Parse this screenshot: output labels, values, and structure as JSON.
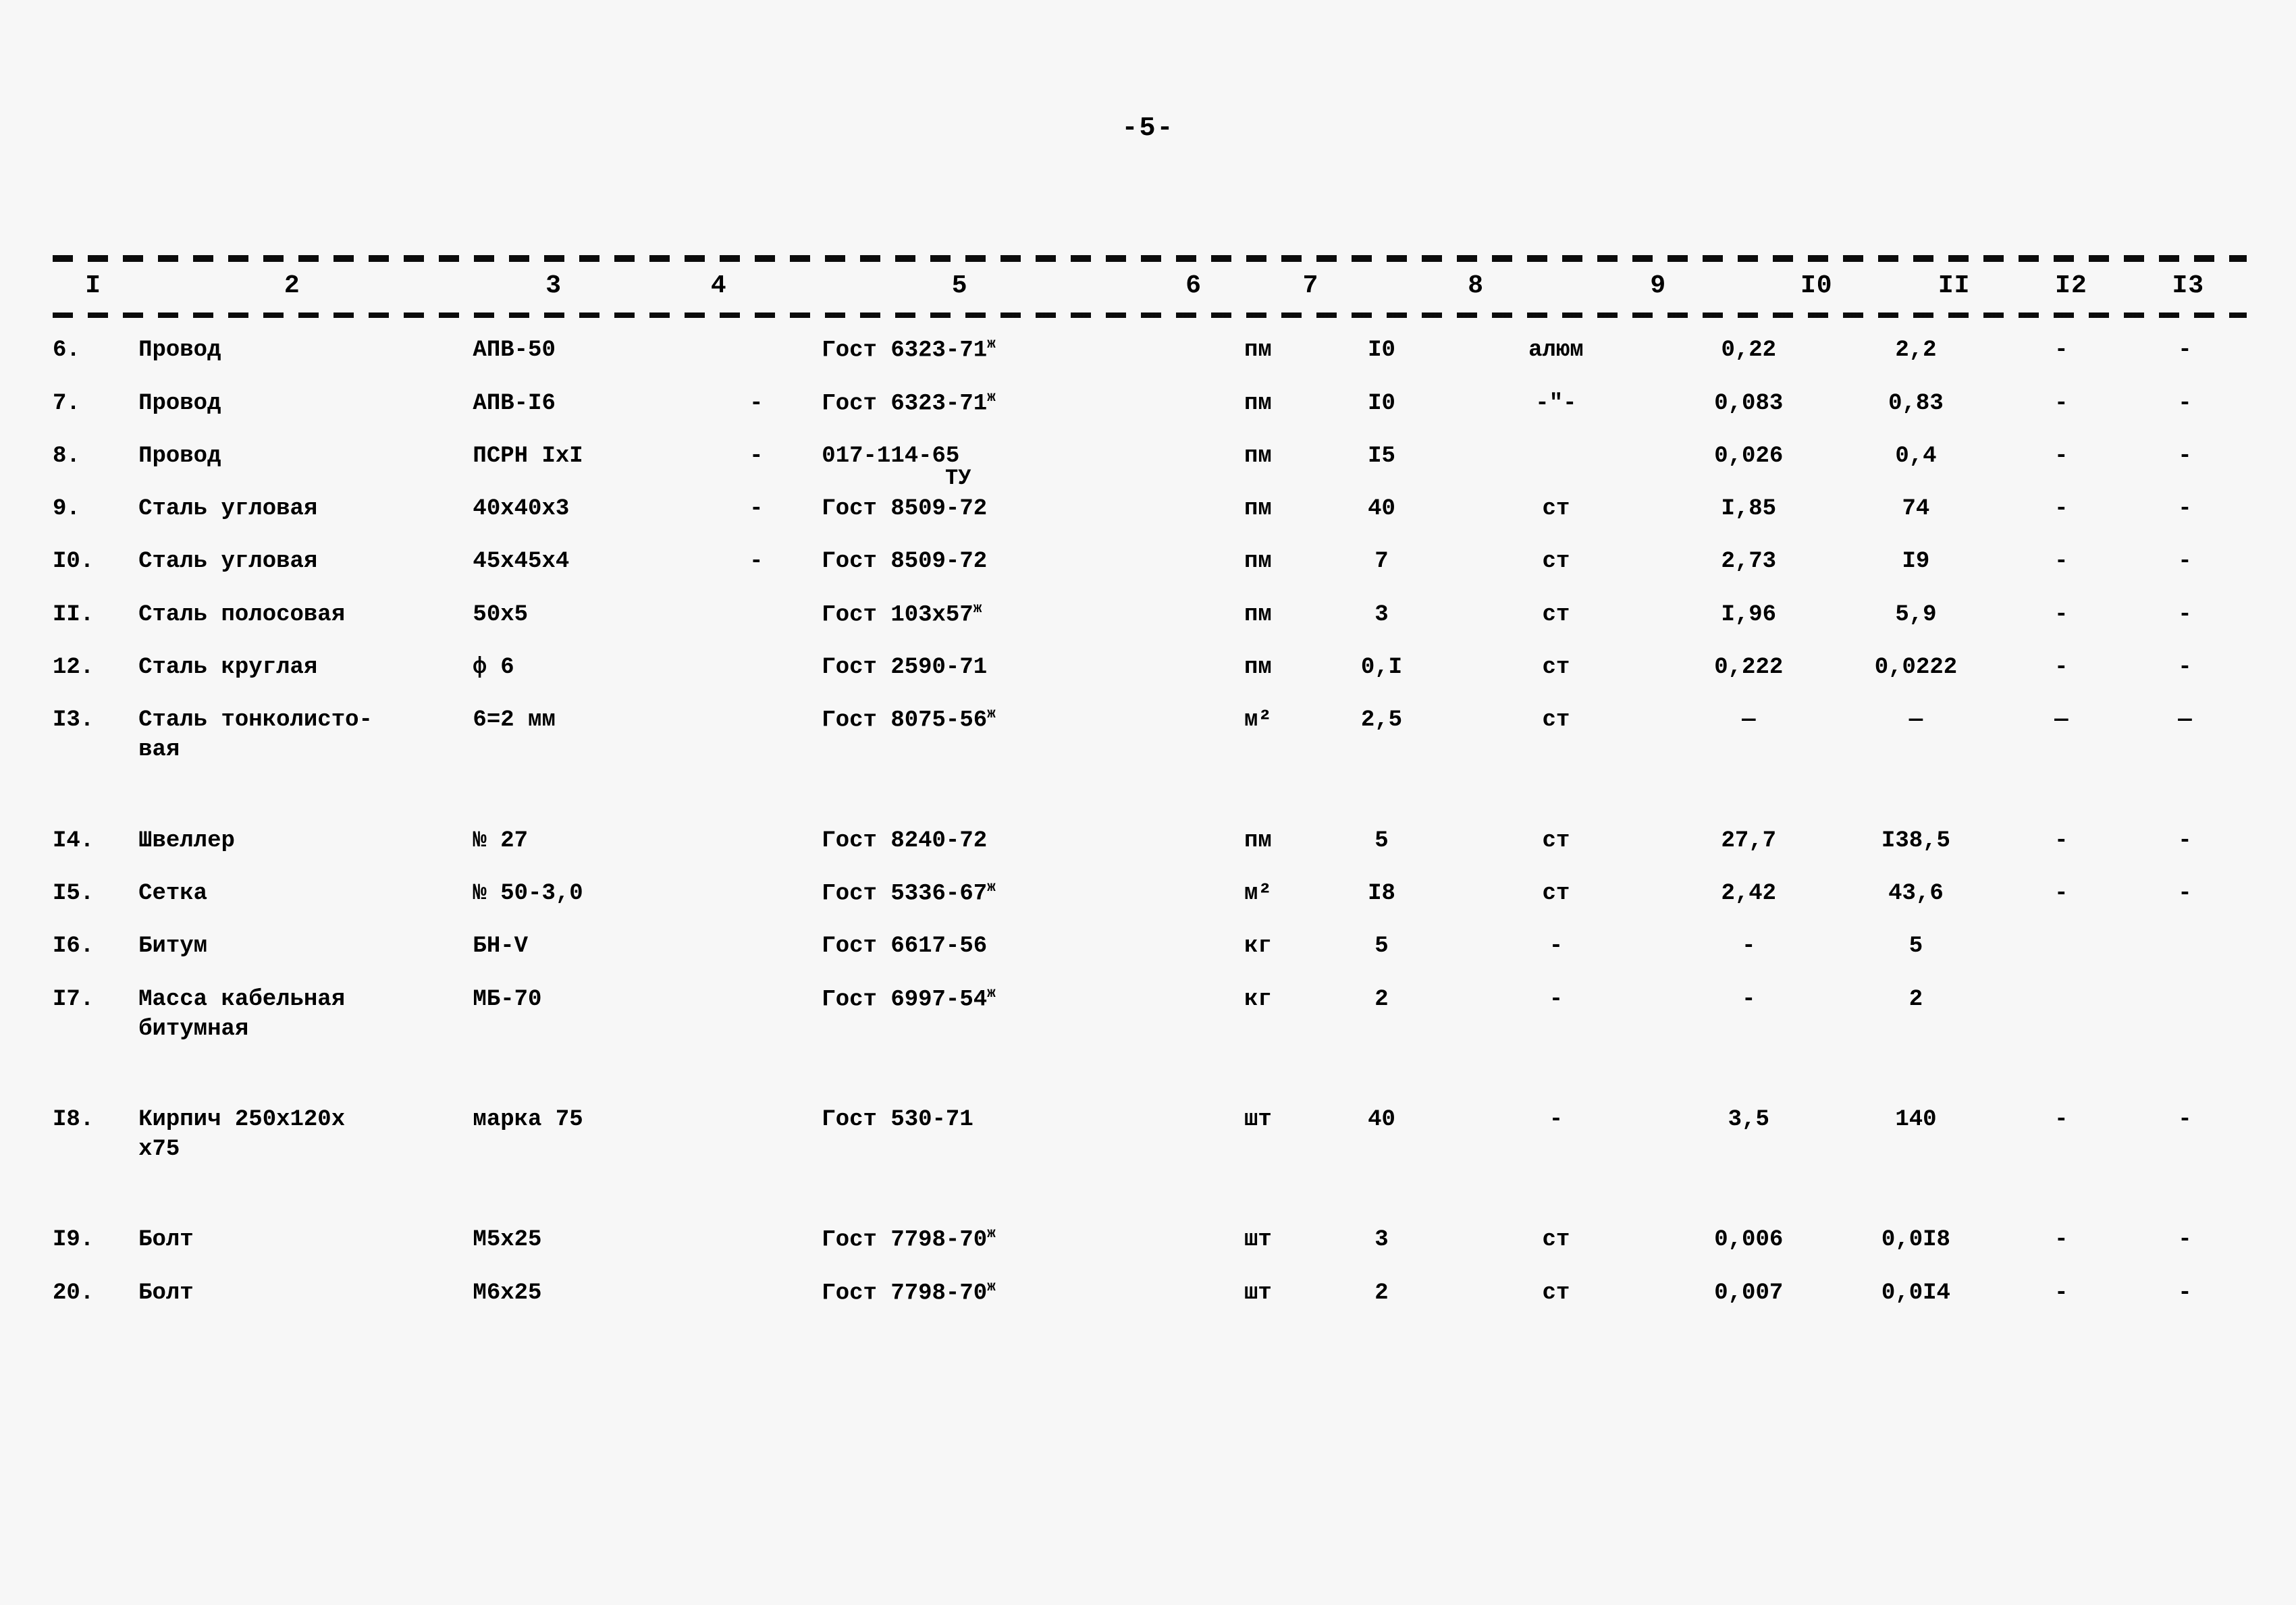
{
  "document": {
    "page_number": "-5-",
    "note_tu": "ТУ"
  },
  "table": {
    "column_headers": [
      "I",
      "2",
      "3",
      "4",
      "5",
      "6",
      "7",
      "8",
      "9",
      "I0",
      "II",
      "I2",
      "I3"
    ],
    "rows": [
      {
        "no": "6.",
        "name": "Провод",
        "mark": "АПВ-50",
        "c5": "",
        "standard": "Гост 6323-71",
        "standard_sup": "ж",
        "unit": "пм",
        "qty": "I0",
        "material": "алюм",
        "unit_weight": "0,22",
        "total_weight": "2,2",
        "c12": "-",
        "c13": "-"
      },
      {
        "no": "7.",
        "name": "Провод",
        "mark": "АПВ-I6",
        "c5": "-",
        "standard": "Гост 6323-71",
        "standard_sup": "ж",
        "unit": "пм",
        "qty": "I0",
        "material": "-\"-",
        "unit_weight": "0,083",
        "total_weight": "0,83",
        "c12": "-",
        "c13": "-"
      },
      {
        "no": "8.",
        "name": "Провод",
        "mark": "ПСРН IxI",
        "c5": "-",
        "standard": "017-114-65",
        "standard_sup": "",
        "unit": "пм",
        "qty": "I5",
        "material": "",
        "unit_weight": "0,026",
        "total_weight": "0,4",
        "c12": "-",
        "c13": "-"
      },
      {
        "no": "9.",
        "name": "Сталь угловая",
        "mark": "40х40х3",
        "c5": "-",
        "standard": "Гост 8509-72",
        "standard_sup": "",
        "unit": "пм",
        "qty": "40",
        "material": "ст",
        "unit_weight": "I,85",
        "total_weight": "74",
        "c12": "-",
        "c13": "-"
      },
      {
        "no": "I0.",
        "name": "Сталь угловая",
        "mark": "45х45х4",
        "c5": "-",
        "standard": "Гост 8509-72",
        "standard_sup": "",
        "unit": "пм",
        "qty": "7",
        "material": "ст",
        "unit_weight": "2,73",
        "total_weight": "I9",
        "c12": "-",
        "c13": "-"
      },
      {
        "no": "II.",
        "name": "Сталь полосовая",
        "mark": "50х5",
        "c5": "",
        "standard": "Гост 103х57",
        "standard_sup": "ж",
        "unit": "пм",
        "qty": "3",
        "material": "ст",
        "unit_weight": "I,96",
        "total_weight": "5,9",
        "c12": "-",
        "c13": "-"
      },
      {
        "no": "12.",
        "name": "Сталь круглая",
        "mark": "ф 6",
        "c5": "",
        "standard": "Гост 2590-71",
        "standard_sup": "",
        "unit": "пм",
        "qty": "0,I",
        "material": "ст",
        "unit_weight": "0,222",
        "total_weight": "0,0222",
        "c12": "-",
        "c13": "-"
      },
      {
        "no": "I3.",
        "name": "Сталь тонколисто-\nвая",
        "mark": "6=2 мм",
        "c5": "",
        "standard": "Гост 8075-56",
        "standard_sup": "ж",
        "unit": "м²",
        "qty": "2,5",
        "material": "ст",
        "unit_weight": "—",
        "total_weight": "—",
        "c12": "—",
        "c13": "—"
      },
      {
        "no": "I4.",
        "name": "Швеллер",
        "mark": "№ 27",
        "c5": "",
        "standard": "Гост 8240-72",
        "standard_sup": "",
        "unit": "пм",
        "qty": "5",
        "material": "ст",
        "unit_weight": "27,7",
        "total_weight": "I38,5",
        "c12": "-",
        "c13": "-"
      },
      {
        "no": "I5.",
        "name": "Сетка",
        "mark": "№ 50-3,0",
        "c5": "",
        "standard": "Гост 5336-67",
        "standard_sup": "ж",
        "unit": "м²",
        "qty": "I8",
        "material": "ст",
        "unit_weight": "2,42",
        "total_weight": "43,6",
        "c12": "-",
        "c13": "-"
      },
      {
        "no": "I6.",
        "name": "Битум",
        "mark": "БН-V",
        "c5": "",
        "standard": "Гост 6617-56",
        "standard_sup": "",
        "unit": "кг",
        "qty": "5",
        "material": "-",
        "unit_weight": "-",
        "total_weight": "5",
        "c12": "",
        "c13": ""
      },
      {
        "no": "I7.",
        "name": "Масса кабельная\nбитумная",
        "mark": "МБ-70",
        "c5": "",
        "standard": "Гост 6997-54",
        "standard_sup": "ж",
        "unit": "кг",
        "qty": "2",
        "material": "-",
        "unit_weight": "-",
        "total_weight": "2",
        "c12": "",
        "c13": ""
      },
      {
        "no": "I8.",
        "name": "Кирпич 250х120х\n     х75",
        "mark": "марка 75",
        "c5": "",
        "standard": "Гост 530-71",
        "standard_sup": "",
        "unit": "шт",
        "qty": "40",
        "material": "-",
        "unit_weight": "3,5",
        "total_weight": "140",
        "c12": "-",
        "c13": "-"
      },
      {
        "no": "I9.",
        "name": "Болт",
        "mark": "М5х25",
        "c5": "",
        "standard": "Гост 7798-70",
        "standard_sup": "ж",
        "unit": "шт",
        "qty": "3",
        "material": "ст",
        "unit_weight": "0,006",
        "total_weight": "0,0I8",
        "c12": "-",
        "c13": "-"
      },
      {
        "no": "20.",
        "name": "Болт",
        "mark": "М6х25",
        "c5": "",
        "standard": "Гост 7798-70",
        "standard_sup": "ж",
        "unit": "шт",
        "qty": "2",
        "material": "ст",
        "unit_weight": "0,007",
        "total_weight": "0,0I4",
        "c12": "-",
        "c13": "-"
      }
    ]
  }
}
